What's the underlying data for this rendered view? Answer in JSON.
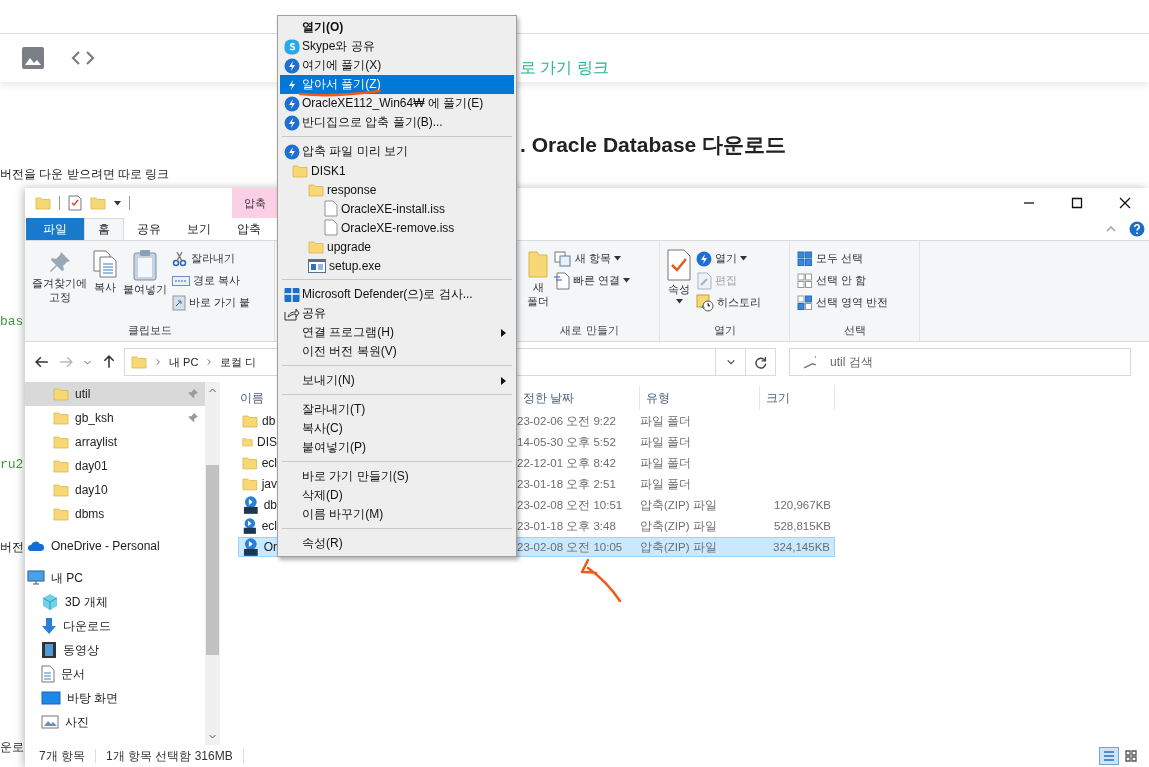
{
  "blog": {
    "texts": [
      {
        "kind": "link",
        "text": "로 가기 링크"
      },
      {
        "kind": "heading",
        "text": ". Oracle Database 다운로드"
      },
      {
        "kind": "body",
        "text": "버전을 다운 받으려면 따로 링크"
      },
      {
        "kind": "code",
        "text": "bas"
      },
      {
        "kind": "code",
        "text": "ru2"
      },
      {
        "kind": "body",
        "text": "버전"
      },
      {
        "kind": "body",
        "text": "운로"
      }
    ]
  },
  "explorer": {
    "contextual_tab": "압축",
    "tabs": [
      {
        "label": "파일",
        "kind": "file",
        "selected": false
      },
      {
        "label": "홈",
        "kind": "tab",
        "selected": true
      },
      {
        "label": "공유",
        "kind": "tab",
        "selected": false
      },
      {
        "label": "보기",
        "kind": "tab",
        "selected": false
      },
      {
        "label": "압축",
        "kind": "tab",
        "selected": false
      }
    ],
    "ribbon": [
      {
        "title": "클립보드",
        "items": [
          {
            "kind": "large",
            "label": "즐겨찾기에\n고정",
            "disabled": false
          },
          {
            "kind": "large",
            "label": "복사",
            "disabled": false
          },
          {
            "kind": "large",
            "label": "붙여넣기",
            "disabled": false
          },
          {
            "kind": "small",
            "label": "잘라내기",
            "disabled": false
          },
          {
            "kind": "small",
            "label": "경로 복사",
            "disabled": false
          },
          {
            "kind": "small",
            "label": "바로 가기 붙",
            "disabled": false
          }
        ]
      },
      {
        "title": "새로 만들기",
        "items": [
          {
            "kind": "large",
            "label": "새\n폴더",
            "disabled": false
          },
          {
            "kind": "small",
            "label": "새 항목",
            "dropdown": true,
            "disabled": false
          },
          {
            "kind": "small",
            "label": "빠른 연결",
            "dropdown": true,
            "disabled": false
          }
        ]
      },
      {
        "title": "열기",
        "items": [
          {
            "kind": "large",
            "label": "속성",
            "dropdown": true,
            "disabled": false
          },
          {
            "kind": "small",
            "label": "열기",
            "dropdown": true,
            "disabled": false
          },
          {
            "kind": "small",
            "label": "편집",
            "disabled": true
          },
          {
            "kind": "small",
            "label": "히스토리",
            "disabled": false
          }
        ]
      },
      {
        "title": "선택",
        "items": [
          {
            "kind": "small",
            "label": "모두 선택",
            "disabled": false
          },
          {
            "kind": "small",
            "label": "선택 안 함",
            "disabled": false
          },
          {
            "kind": "small",
            "label": "선택 영역 반전",
            "disabled": false
          }
        ]
      }
    ],
    "address": {
      "crumbs": [
        "내 PC",
        "로컬 디"
      ]
    },
    "search": {
      "placeholder": "util 검색"
    },
    "quick_access": [
      {
        "label": "util",
        "pinned": true,
        "selected": true
      },
      {
        "label": "gb_ksh",
        "pinned": true,
        "selected": false
      },
      {
        "label": "arraylist",
        "pinned": false,
        "selected": false
      },
      {
        "label": "day01",
        "pinned": false,
        "selected": false
      },
      {
        "label": "day10",
        "pinned": false,
        "selected": false
      },
      {
        "label": "dbms",
        "pinned": false,
        "selected": false
      }
    ],
    "places": [
      {
        "label": "OneDrive - Personal",
        "kind": "cloud",
        "selected": false
      },
      {
        "label": "내 PC",
        "kind": "pc",
        "selected": false,
        "children": [
          {
            "label": "3D 개체",
            "kind": "cube",
            "selected": false
          },
          {
            "label": "다운로드",
            "kind": "download",
            "selected": false
          },
          {
            "label": "동영상",
            "kind": "video",
            "selected": false
          },
          {
            "label": "문서",
            "kind": "document",
            "selected": false
          },
          {
            "label": "바탕 화면",
            "kind": "desktop",
            "selected": false
          },
          {
            "label": "사진",
            "kind": "picture",
            "selected": false
          }
        ]
      }
    ],
    "columns": [
      "이름",
      "정한 날짜",
      "유형",
      "크기"
    ],
    "rows": [
      {
        "name": "db",
        "modified": "23-02-06 오전 9:22",
        "type": "파일 폴더",
        "kind": "folder",
        "selected": false
      },
      {
        "name": "DIS",
        "modified": "14-05-30 오후 5:52",
        "type": "파일 폴더",
        "kind": "folder",
        "selected": false
      },
      {
        "name": "ecl",
        "modified": "22-12-01 오후 8:42",
        "type": "파일 폴더",
        "kind": "folder",
        "selected": false
      },
      {
        "name": "jav",
        "modified": "23-01-18 오후 2:51",
        "type": "파일 폴더",
        "kind": "folder",
        "selected": false
      },
      {
        "name": "db",
        "modified": "23-02-08 오전 10:51",
        "type": "압축(ZIP) 파일",
        "size": "120,967KB",
        "kind": "zip",
        "selected": false
      },
      {
        "name": "ecl",
        "modified": "23-01-18 오후 3:48",
        "type": "압축(ZIP) 파일",
        "size": "528,815KB",
        "kind": "zip",
        "selected": false
      },
      {
        "name": "Or",
        "modified": "23-02-08 오전 10:05",
        "type": "압축(ZIP) 파일",
        "size": "324,145KB",
        "kind": "zip",
        "selected": true
      }
    ],
    "status": [
      "7개 항목",
      "1개 항목 선택함 316MB"
    ]
  },
  "context_menu": {
    "items": [
      {
        "kind": "item",
        "label": "열기(O)",
        "default": true,
        "selected": false
      },
      {
        "kind": "item",
        "label": "Skype와 공유",
        "selected": false
      },
      {
        "kind": "item",
        "label": "여기에 풀기(X)",
        "selected": false
      },
      {
        "kind": "item",
        "label": "알아서 풀기(Z)",
        "selected": true
      },
      {
        "kind": "item",
        "label": "OracleXE112_Win64₩ 에 풀기(E)",
        "selected": false
      },
      {
        "kind": "item",
        "label": "반디집으로 압축 풀기(B)...",
        "selected": false
      },
      {
        "kind": "separator"
      },
      {
        "kind": "tree",
        "label": "압축 파일 미리 보기",
        "selected": false,
        "children": [
          {
            "label": "DISK1",
            "kind": "folder",
            "children": [
              {
                "label": "response",
                "kind": "folder",
                "children": [
                  {
                    "label": "OracleXE-install.iss",
                    "kind": "file"
                  },
                  {
                    "label": "OracleXE-remove.iss",
                    "kind": "file"
                  }
                ]
              },
              {
                "label": "upgrade",
                "kind": "folder"
              },
              {
                "label": "setup.exe",
                "kind": "exe"
              }
            ]
          }
        ]
      },
      {
        "kind": "separator"
      },
      {
        "kind": "item",
        "label": "Microsoft Defender(으)로 검사...",
        "selected": false
      },
      {
        "kind": "item",
        "label": "공유",
        "selected": false
      },
      {
        "kind": "item",
        "label": "연결 프로그램(H)",
        "submenu": true,
        "selected": false
      },
      {
        "kind": "item",
        "label": "이전 버전 복원(V)",
        "selected": false
      },
      {
        "kind": "separator"
      },
      {
        "kind": "item",
        "label": "보내기(N)",
        "submenu": true,
        "selected": false
      },
      {
        "kind": "separator"
      },
      {
        "kind": "item",
        "label": "잘라내기(T)",
        "selected": false
      },
      {
        "kind": "item",
        "label": "복사(C)",
        "selected": false
      },
      {
        "kind": "item",
        "label": "붙여넣기(P)",
        "selected": false
      },
      {
        "kind": "separator"
      },
      {
        "kind": "item",
        "label": "바로 가기 만들기(S)",
        "selected": false
      },
      {
        "kind": "item",
        "label": "삭제(D)",
        "selected": false
      },
      {
        "kind": "item",
        "label": "이름 바꾸기(M)",
        "selected": false
      },
      {
        "kind": "separator"
      },
      {
        "kind": "item",
        "label": "속성(R)",
        "selected": false
      }
    ]
  }
}
